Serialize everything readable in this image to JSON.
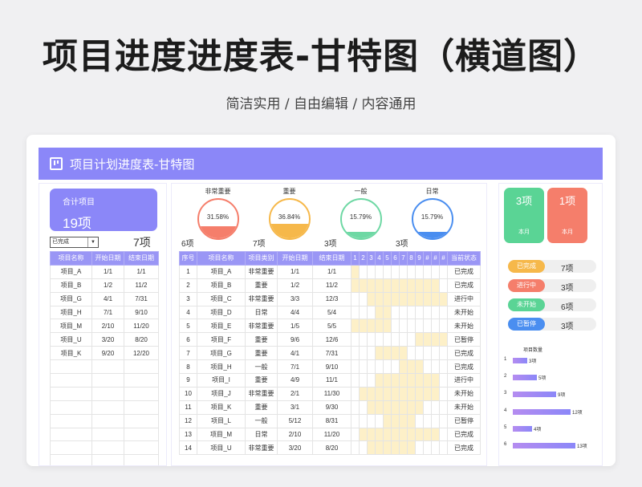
{
  "hero": {
    "title": "项目进度进度表-甘特图（横道图）",
    "subtitle": "简洁实用 / 自由编辑 / 内容通用"
  },
  "banner": {
    "title": "项目计划进度表-甘特图",
    "icon": "chart-board-icon"
  },
  "summary": {
    "label": "合计项目",
    "value": "19项",
    "filter_value": "已完成",
    "filter_count": "7项"
  },
  "left_table": {
    "headers": [
      "项目名称",
      "开始日期",
      "结束日期"
    ],
    "rows": [
      [
        "项目_A",
        "1/1",
        "1/1"
      ],
      [
        "项目_B",
        "1/2",
        "11/2"
      ],
      [
        "项目_G",
        "4/1",
        "7/31"
      ],
      [
        "项目_H",
        "7/1",
        "9/10"
      ],
      [
        "项目_M",
        "2/10",
        "11/20"
      ],
      [
        "项目_U",
        "3/20",
        "8/20"
      ],
      [
        "项目_K",
        "9/20",
        "12/20"
      ]
    ],
    "blank_rows": 8
  },
  "gauges": [
    {
      "label": "非常重要",
      "percent": "31.58%",
      "fill": 0.3158,
      "count": "6项",
      "color": "#f57e6b"
    },
    {
      "label": "重要",
      "percent": "36.84%",
      "fill": 0.3684,
      "count": "7项",
      "color": "#f6b84a"
    },
    {
      "label": "一般",
      "percent": "15.79%",
      "fill": 0.1579,
      "count": "3项",
      "color": "#6ed8a4"
    },
    {
      "label": "日常",
      "percent": "15.79%",
      "fill": 0.1579,
      "count": "3项",
      "color": "#4a8ef0"
    }
  ],
  "main_table": {
    "headers": [
      "序号",
      "项目名称",
      "项目类别",
      "开始日期",
      "结束日期",
      "1",
      "2",
      "3",
      "4",
      "5",
      "6",
      "7",
      "8",
      "9",
      "#",
      "#",
      "#",
      "当前状态"
    ],
    "rows": [
      {
        "cells": [
          "1",
          "项目_A",
          "非常重要",
          "1/1",
          "1/1"
        ],
        "status": "已完成",
        "bar": [
          0,
          1
        ]
      },
      {
        "cells": [
          "2",
          "项目_B",
          "重要",
          "1/2",
          "11/2"
        ],
        "status": "已完成",
        "bar": [
          0,
          11
        ]
      },
      {
        "cells": [
          "3",
          "项目_C",
          "非常重要",
          "3/3",
          "12/3"
        ],
        "status": "进行中",
        "bar": [
          2,
          12
        ]
      },
      {
        "cells": [
          "4",
          "项目_D",
          "日常",
          "4/4",
          "5/4"
        ],
        "status": "未开始",
        "bar": [
          3,
          5
        ]
      },
      {
        "cells": [
          "5",
          "项目_E",
          "非常重要",
          "1/5",
          "5/5"
        ],
        "status": "未开始",
        "bar": [
          0,
          5
        ]
      },
      {
        "cells": [
          "6",
          "项目_F",
          "重要",
          "9/6",
          "12/6"
        ],
        "status": "已暂停",
        "bar": [
          8,
          12
        ]
      },
      {
        "cells": [
          "7",
          "项目_G",
          "重要",
          "4/1",
          "7/31"
        ],
        "status": "已完成",
        "bar": [
          3,
          7
        ]
      },
      {
        "cells": [
          "8",
          "项目_H",
          "一般",
          "7/1",
          "9/10"
        ],
        "status": "已完成",
        "bar": [
          6,
          9
        ]
      },
      {
        "cells": [
          "9",
          "项目_I",
          "重要",
          "4/9",
          "11/1"
        ],
        "status": "进行中",
        "bar": [
          3,
          11
        ]
      },
      {
        "cells": [
          "10",
          "项目_J",
          "非常重要",
          "2/1",
          "11/30"
        ],
        "status": "未开始",
        "bar": [
          1,
          11
        ]
      },
      {
        "cells": [
          "11",
          "项目_K",
          "重要",
          "3/1",
          "9/30"
        ],
        "status": "未开始",
        "bar": [
          2,
          9
        ]
      },
      {
        "cells": [
          "12",
          "项目_L",
          "一般",
          "5/12",
          "8/31"
        ],
        "status": "已暂停",
        "bar": [
          4,
          8
        ]
      },
      {
        "cells": [
          "13",
          "项目_M",
          "日常",
          "2/10",
          "11/20"
        ],
        "status": "已完成",
        "bar": [
          1,
          11
        ]
      },
      {
        "cells": [
          "14",
          "项目_U",
          "非常重要",
          "3/20",
          "8/20"
        ],
        "status": "已完成",
        "bar": [
          2,
          8
        ]
      }
    ]
  },
  "kpis": [
    {
      "value": "3项",
      "label": "本月",
      "color": "#5ad495"
    },
    {
      "value": "1项",
      "label": "本月",
      "color": "#f57e6b"
    }
  ],
  "statuses": [
    {
      "label": "已完成",
      "count": "7项",
      "color": "#f6b84a"
    },
    {
      "label": "进行中",
      "count": "3项",
      "color": "#f57e6b"
    },
    {
      "label": "未开始",
      "count": "6项",
      "color": "#5ad495"
    },
    {
      "label": "已暂停",
      "count": "3项",
      "color": "#4a8ef0"
    }
  ],
  "bar_chart": {
    "title": "项目数量",
    "rows": [
      {
        "k": "1",
        "v": "3项",
        "n": 3
      },
      {
        "k": "2",
        "v": "5项",
        "n": 5
      },
      {
        "k": "3",
        "v": "9项",
        "n": 9
      },
      {
        "k": "4",
        "v": "12项",
        "n": 12
      },
      {
        "k": "5",
        "v": "4项",
        "n": 4
      },
      {
        "k": "6",
        "v": "13项",
        "n": 13
      }
    ]
  }
}
